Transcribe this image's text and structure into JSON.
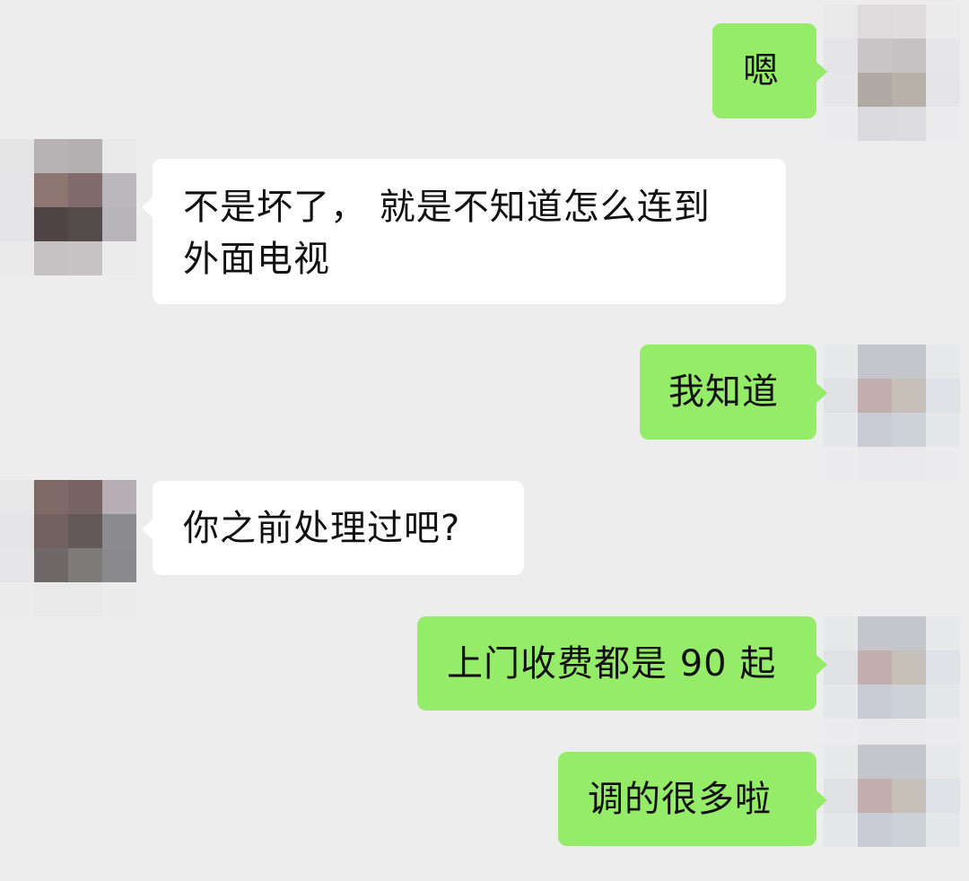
{
  "conversation": {
    "messages": [
      {
        "sender": "self",
        "text": "嗯",
        "avatar_icon": "pixelated-avatar-icon"
      },
      {
        "sender": "other",
        "text": "不是坏了， 就是不知道怎么连到\n外面电视",
        "avatar_icon": "pixelated-avatar-icon"
      },
      {
        "sender": "self",
        "text": "我知道",
        "avatar_icon": "pixelated-avatar-icon"
      },
      {
        "sender": "other",
        "text": "你之前处理过吧?",
        "avatar_icon": "pixelated-avatar-icon"
      },
      {
        "sender": "self",
        "text": "上门收费都是 90 起",
        "avatar_icon": "pixelated-avatar-icon"
      },
      {
        "sender": "self",
        "text": "调的很多啦",
        "avatar_icon": "pixelated-avatar-icon"
      }
    ]
  },
  "colors": {
    "background": "#ededed",
    "self_bubble": "#95ec69",
    "other_bubble": "#ffffff",
    "text": "#111111"
  }
}
